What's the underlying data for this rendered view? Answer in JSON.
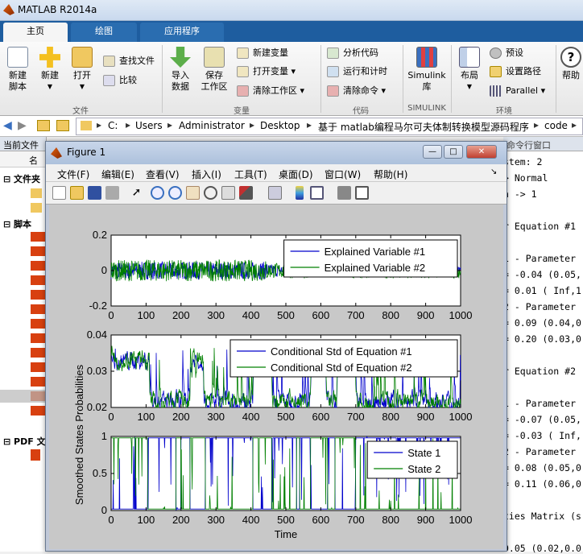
{
  "app": {
    "title": "MATLAB R2014a"
  },
  "ribbon_tabs": [
    {
      "label": "主页"
    },
    {
      "label": "绘图"
    },
    {
      "label": "应用程序"
    }
  ],
  "ribbon": {
    "file": {
      "new_script": "新建\n脚本",
      "new": "新建",
      "open": "打开",
      "find_files": "查找文件",
      "compare": "比较",
      "group": "文件"
    },
    "variable": {
      "import": "导入\n数据",
      "save_ws": "保存\n工作区",
      "new_var": "新建变量",
      "open_var": "打开变量",
      "clear_ws": "清除工作区",
      "group": "变量"
    },
    "code": {
      "analyze": "分析代码",
      "run_time": "运行和计时",
      "clear_cmd": "清除命令",
      "group": "代码"
    },
    "simulink": {
      "lib": "Simulink\n库",
      "group": "SIMULINK"
    },
    "env": {
      "layout": "布局",
      "prefs": "预设",
      "set_path": "设置路径",
      "parallel": "Parallel",
      "group": "环境"
    },
    "help": "帮助"
  },
  "address": {
    "crumbs": [
      "C:",
      "Users",
      "Administrator",
      "Desktop",
      "基于 matlab编程马尔可夫体制转换模型源码程序",
      "code"
    ]
  },
  "left_panel": {
    "header": "当前文件",
    "col": "名",
    "sec1": "文件夹",
    "sec2": "脚本",
    "sec3": "PDF 文"
  },
  "cmd_window": {
    "header": "命令行窗口",
    "lines": [
      "stem: 2",
      "> Normal",
      "n -> 1",
      "",
      "r Equation #1",
      "",
      "1 - Parameter",
      "= -0.04 (0.05,",
      "= 0.01 ( Inf,1",
      "2 - Parameter",
      "= 0.09 (0.04,0",
      "= 0.20 (0.03,0",
      "",
      "r Equation #2",
      "",
      "1 - Parameter",
      "= -0.07 (0.05,",
      "= -0.03 ( Inf,",
      "2 - Parameter",
      "= 0.08 (0.05,0",
      "= 0.11 (0.06,0",
      "",
      "ties Matrix (s",
      "",
      "0.05 (0.02,0.0"
    ]
  },
  "figure": {
    "title": "Figure 1",
    "menu": [
      "文件(F)",
      "编辑(E)",
      "查看(V)",
      "插入(I)",
      "工具(T)",
      "桌面(D)",
      "窗口(W)",
      "帮助(H)"
    ]
  },
  "chart_data": [
    {
      "type": "line",
      "x_range": [
        0,
        1000
      ],
      "ylim": [
        -0.2,
        0.2
      ],
      "yticks": [
        "0.2",
        "0",
        "-0.2"
      ],
      "xticks": [
        "0",
        "100",
        "200",
        "300",
        "400",
        "500",
        "600",
        "700",
        "800",
        "900",
        "1000"
      ],
      "series": [
        {
          "name": "Explained Variable #1",
          "color": "#0000cc"
        },
        {
          "name": "Explained Variable #2",
          "color": "#008000"
        }
      ],
      "legend": "top-right"
    },
    {
      "type": "line",
      "x_range": [
        0,
        1000
      ],
      "ylim": [
        0.02,
        0.04
      ],
      "yticks": [
        "0.04",
        "0.03",
        "0.02"
      ],
      "xticks": [
        "0",
        "100",
        "200",
        "300",
        "400",
        "500",
        "600",
        "700",
        "800",
        "900",
        "1000"
      ],
      "series": [
        {
          "name": "Conditional Std of Equation #1",
          "color": "#0000cc"
        },
        {
          "name": "Conditional Std of Equation #2",
          "color": "#008000"
        }
      ],
      "legend": "top-right"
    },
    {
      "type": "line",
      "x_range": [
        0,
        1000
      ],
      "ylim": [
        0,
        1
      ],
      "yticks": [
        "1",
        "0.5",
        "0"
      ],
      "xticks": [
        "0",
        "100",
        "200",
        "300",
        "400",
        "500",
        "600",
        "700",
        "800",
        "900",
        "1000"
      ],
      "ylabel": "Smoothed States Probabilities",
      "xlabel": "Time",
      "series": [
        {
          "name": "State 1",
          "color": "#0000cc"
        },
        {
          "name": "State 2",
          "color": "#008000"
        }
      ],
      "legend": "top-right"
    }
  ]
}
